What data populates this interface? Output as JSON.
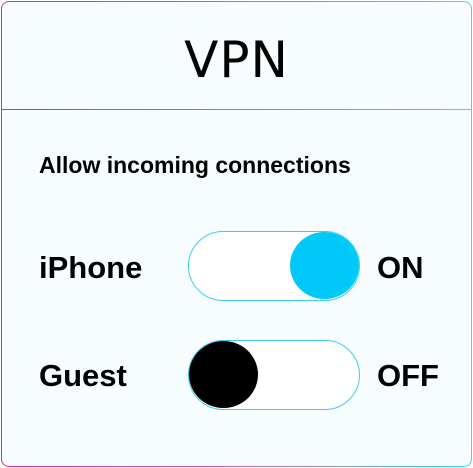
{
  "header": {
    "title": "VPN"
  },
  "section": {
    "subtitle": "Allow incoming connections"
  },
  "rows": [
    {
      "label": "iPhone",
      "state_text": "ON",
      "on": true
    },
    {
      "label": "Guest",
      "state_text": "OFF",
      "on": false
    }
  ],
  "colors": {
    "knob_on": "#00c8f8",
    "knob_off": "#000000",
    "toggle_border": "#3ccfea",
    "border_gradient_start": "#e0288f",
    "border_gradient_end": "#3fd6ee"
  }
}
